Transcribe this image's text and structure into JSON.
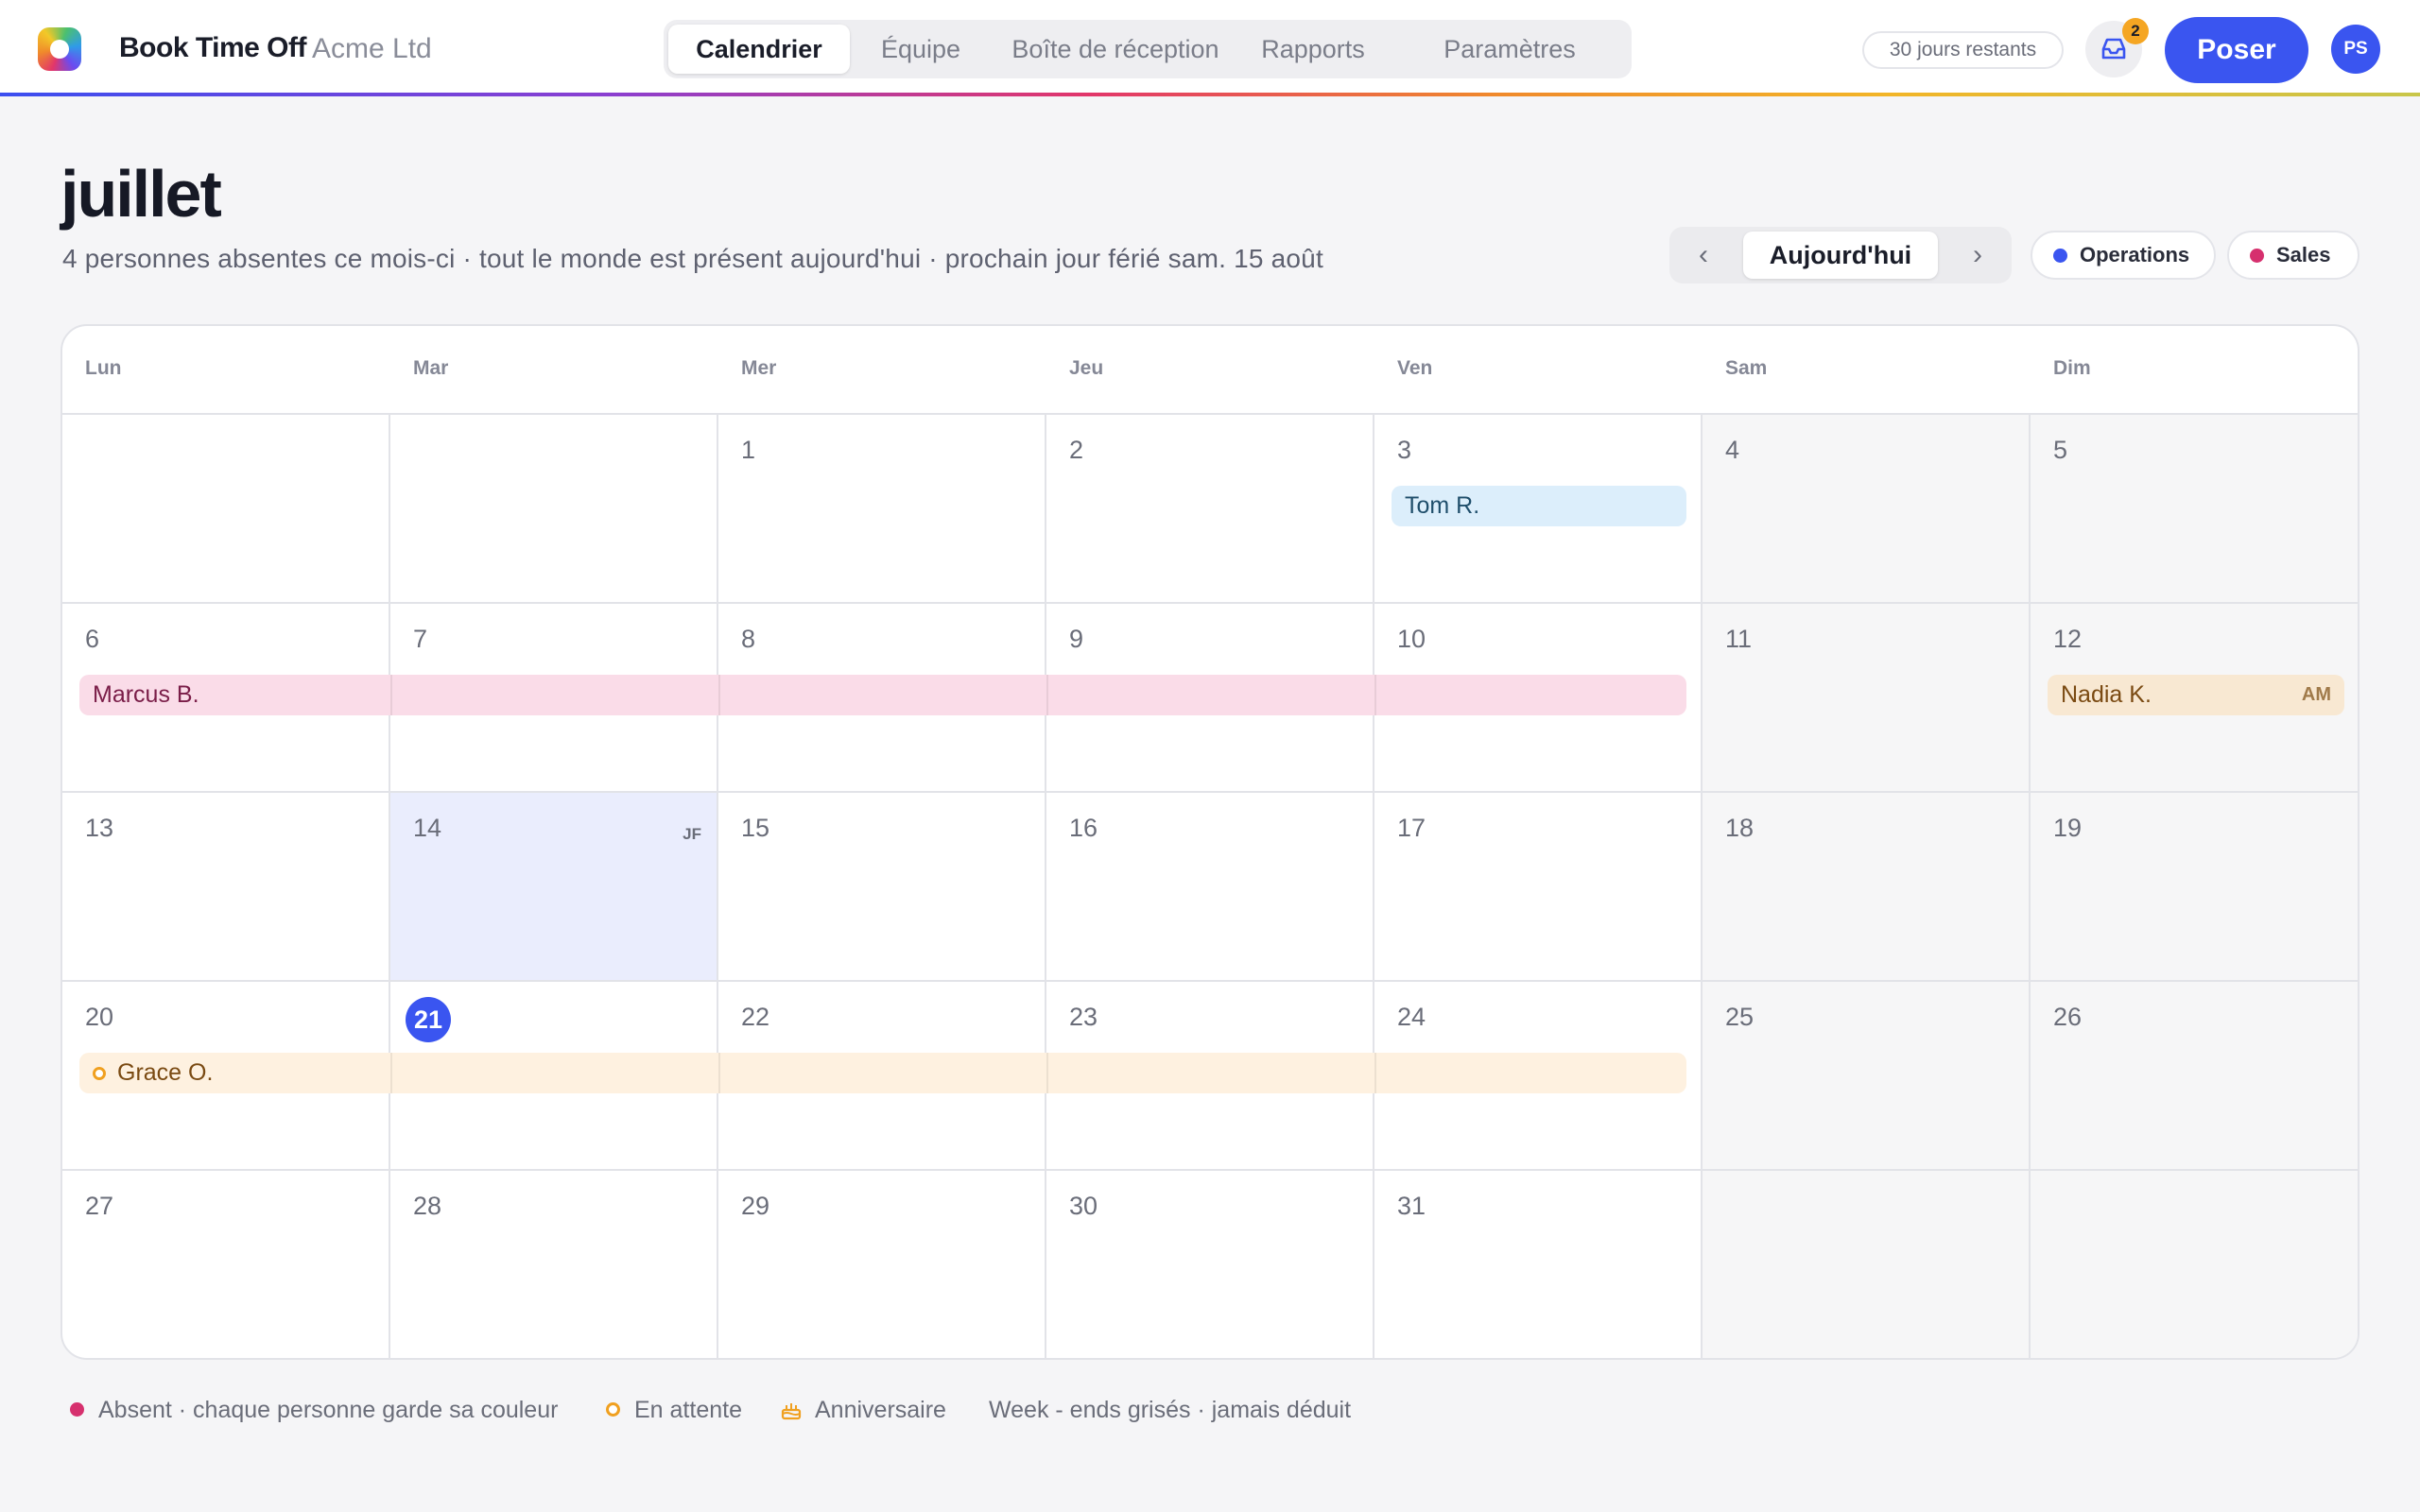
{
  "app": {
    "title": "Book Time Off",
    "org": "Acme Ltd"
  },
  "nav": {
    "tabs": [
      {
        "label": "Calendrier",
        "active": true
      },
      {
        "label": "Équipe"
      },
      {
        "label": "Boîte de réception"
      },
      {
        "label": "Rapports"
      },
      {
        "label": "Paramètres"
      }
    ]
  },
  "topbar": {
    "days_left": "30 jours restants",
    "inbox_count": "2",
    "request_button": "Poser",
    "avatar_initials": "PS"
  },
  "header": {
    "month": "juillet",
    "subtitle": "4 personnes absentes ce mois-ci · tout le monde est présent aujourd'hui · prochain jour férié sam. 15 août",
    "prev_symbol": "‹",
    "today_button": "Aujourd'hui",
    "next_symbol": "›",
    "filters": [
      {
        "label": "Operations",
        "color": "#3a55f0"
      },
      {
        "label": "Sales",
        "color": "#d6306e"
      }
    ]
  },
  "calendar": {
    "weekdays": [
      "Lun",
      "Mar",
      "Mer",
      "Jeu",
      "Ven",
      "Sam",
      "Dim"
    ],
    "today": "21",
    "holiday_tag": "JF",
    "weeks": [
      [
        "",
        "",
        "1",
        "2",
        "3",
        "4",
        "5"
      ],
      [
        "6",
        "7",
        "8",
        "9",
        "10",
        "11",
        "12"
      ],
      [
        "13",
        "14",
        "15",
        "16",
        "17",
        "18",
        "19"
      ],
      [
        "20",
        "21",
        "22",
        "23",
        "24",
        "25",
        "26"
      ],
      [
        "27",
        "28",
        "29",
        "30",
        "31",
        "",
        ""
      ]
    ],
    "events": {
      "tom": "Tom R.",
      "marcus": "Marcus B.",
      "nadia": "Nadia K.",
      "nadia_period": "AM",
      "grace": "Grace O."
    }
  },
  "legend": {
    "absent": "Absent · chaque personne garde sa couleur",
    "pending": "En attente",
    "birthday": "Anniversaire",
    "weekends": "Week - ends grisés · jamais déduit"
  },
  "colors": {
    "accent": "#3a55f0",
    "absent_dot": "#d6306e",
    "pending_ring": "#f0a020",
    "birthday": "#f0a020"
  }
}
